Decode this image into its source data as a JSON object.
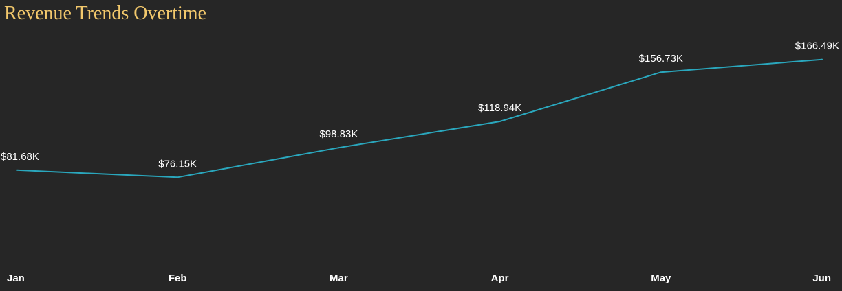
{
  "title": "Revenue Trends Overtime",
  "colors": {
    "background": "#262626",
    "title": "#f2c86c",
    "line": "#2aa7bd",
    "text": "#ffffff"
  },
  "chart_data": {
    "type": "line",
    "title": "Revenue Trends Overtime",
    "categories": [
      "Jan",
      "Feb",
      "Mar",
      "Apr",
      "May",
      "Jun"
    ],
    "series": [
      {
        "values": [
          81680,
          76150,
          98830,
          118940,
          156730,
          166490
        ],
        "labels": [
          "$81.68K",
          "$76.15K",
          "$98.83K",
          "$118.94K",
          "$156.73K",
          "$166.49K"
        ]
      }
    ],
    "ylim": [
      0,
      170000
    ],
    "grid": false,
    "legend": "none",
    "xlabel": "",
    "ylabel": ""
  }
}
